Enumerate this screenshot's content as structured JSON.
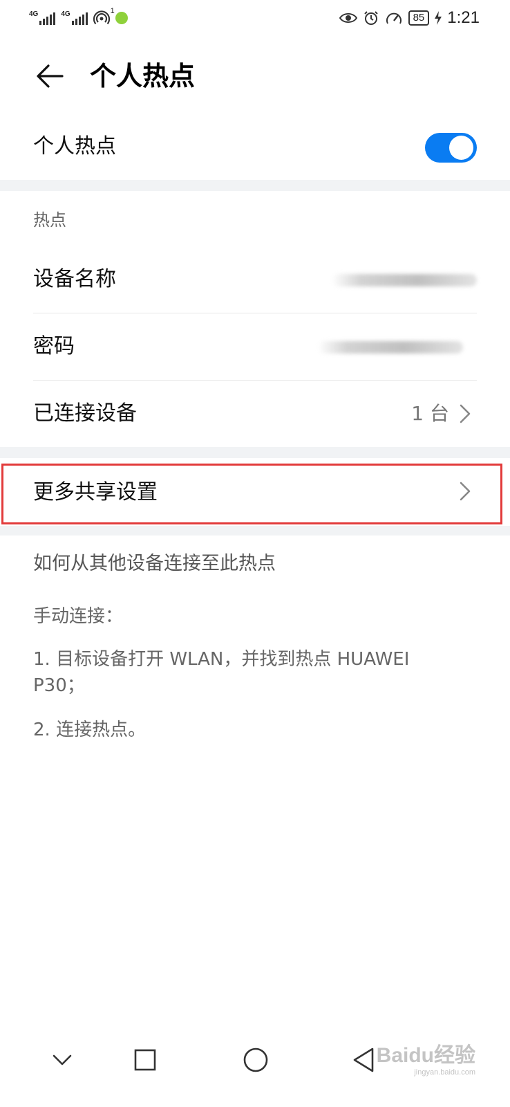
{
  "status_bar": {
    "net1": "4G",
    "net2": "4G",
    "hotspot_count": "1",
    "battery": "85",
    "time": "1:21"
  },
  "header": {
    "title": "个人热点"
  },
  "hotspot_toggle": {
    "label": "个人热点",
    "on": true
  },
  "section": {
    "label": "热点"
  },
  "rows": {
    "device_name": "设备名称",
    "password": "密码",
    "connected": "已连接设备",
    "connected_count": "1 台",
    "more_settings": "更多共享设置"
  },
  "info": {
    "title": "如何从其他设备连接至此热点",
    "manual": "手动连接：",
    "step1": "1. 目标设备打开 WLAN，并找到热点 HUAWEI P30；",
    "step2": "2. 连接热点。"
  },
  "watermark": {
    "brand": "Baidu经验",
    "url": "jingyan.baidu.com"
  },
  "colors": {
    "accent": "#0a7cf2",
    "highlight": "#e23b3b"
  }
}
